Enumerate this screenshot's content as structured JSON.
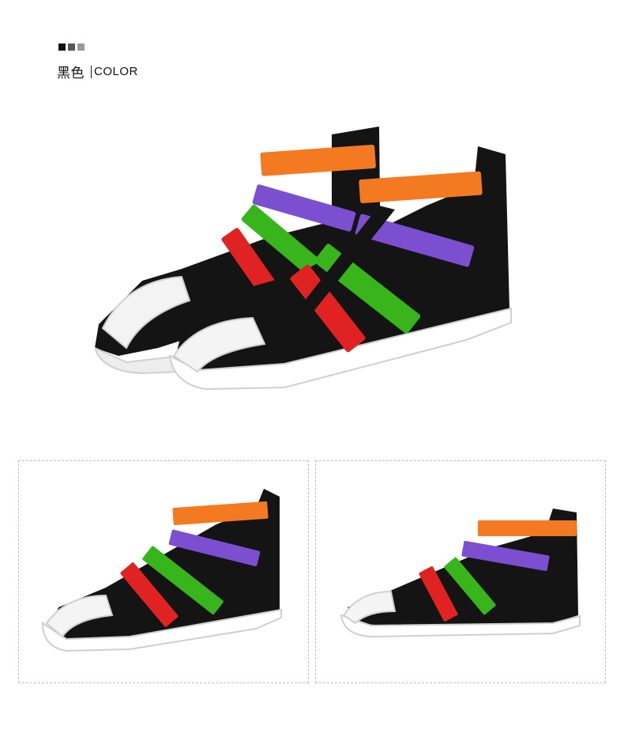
{
  "header": {
    "squares": [
      "#111111",
      "#555555",
      "#999999"
    ],
    "color_cn": "黑色",
    "color_en": "COLOR"
  },
  "product": {
    "strap_colors": {
      "orange": "#f47a21",
      "purple": "#7b4fd0",
      "green": "#39b51c",
      "red": "#e02322",
      "black": "#141414",
      "sole": "#f2f2f2"
    }
  }
}
